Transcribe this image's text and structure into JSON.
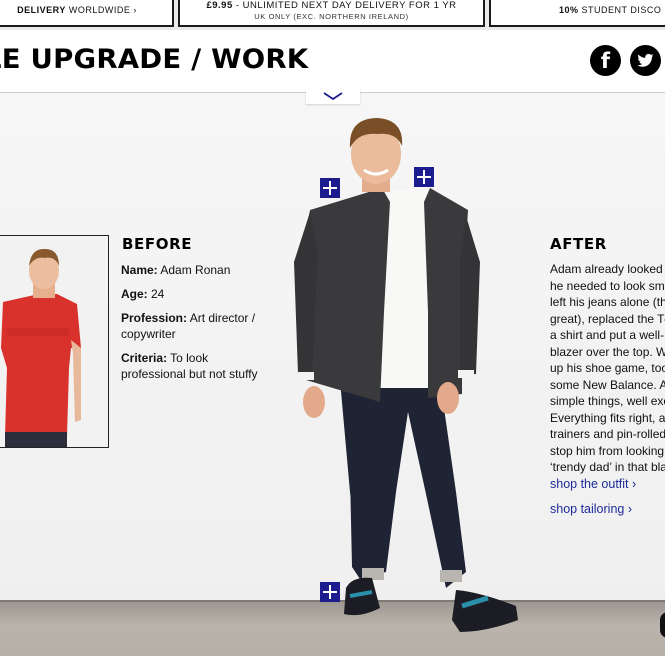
{
  "promos": {
    "p1": {
      "bold": "DELIVERY",
      "text": " WORLDWIDE ›"
    },
    "p2": {
      "bold": "£9.95",
      "text": " - UNLIMITED NEXT DAY DELIVERY FOR 1 YR",
      "sub": "UK ONLY (EXC. NORTHERN IRELAND)"
    },
    "p3": {
      "bold": "10%",
      "text": " STUDENT DISCO"
    }
  },
  "header": {
    "title": "LE UPGRADE / WORK",
    "facebook_glyph": "f"
  },
  "icons": [
    "facebook-icon",
    "twitter-icon",
    "chevron-down-icon",
    "plus-icon"
  ],
  "before": {
    "heading": "BEFORE",
    "name_label": "Name:",
    "name_value": " Adam Ronan",
    "age_label": "Age:",
    "age_value": " 24",
    "profession_label": "Profession:",
    "profession_value": " Art director / copywriter",
    "criteria_label": "Criteria:",
    "criteria_value": " To look professional but not stuffy"
  },
  "after": {
    "heading": "AFTER",
    "lines": [
      "Adam already looked",
      "he needed to look sma",
      "left his jeans alone (the",
      "great), replaced the T-",
      "a shirt and put a well-",
      "blazer over the top. W",
      "up his shoe game, too",
      "some New Balance. A",
      "simple things, well exe",
      "Everything fits right, a",
      "trainers and pin-rolled",
      "stop him from looking",
      "‘trendy dad’ in that bla"
    ],
    "shop_outfit": "shop the outfit ›",
    "shop_tailoring": "shop tailoring ›"
  },
  "colors": {
    "accent_blue": "#1d1c8f",
    "link_blue": "#1d2b9a",
    "tee_red": "#d9322d",
    "blazer": "#3a3a3c",
    "jeans": "#1f2434"
  }
}
